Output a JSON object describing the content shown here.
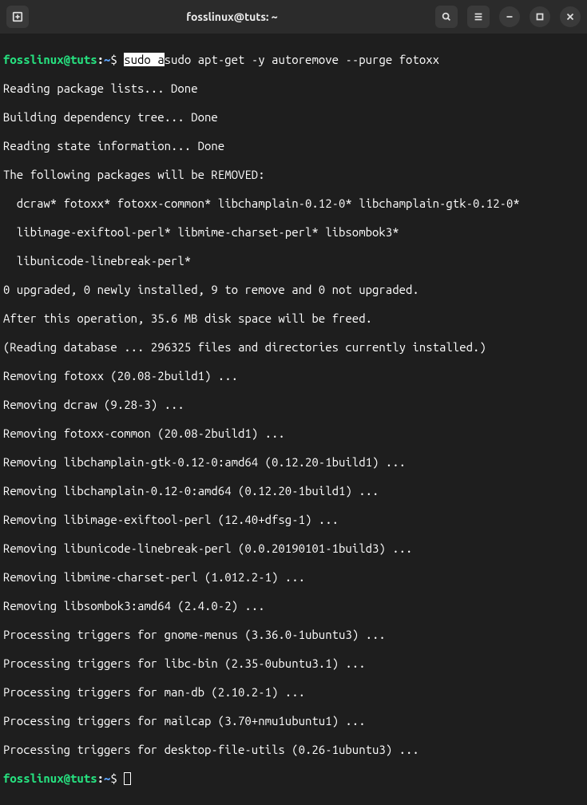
{
  "titlebar": {
    "title": "fosslinux@tuts: ~"
  },
  "prompt": {
    "user_host": "fosslinux@tuts",
    "sep": ":",
    "path": "~",
    "dollar": "$"
  },
  "command": {
    "highlighted": "sudo a",
    "rest": "sudo apt-get -y autoremove --purge fotoxx"
  },
  "output": [
    "Reading package lists... Done",
    "Building dependency tree... Done",
    "Reading state information... Done",
    "The following packages will be REMOVED:",
    "  dcraw* fotoxx* fotoxx-common* libchamplain-0.12-0* libchamplain-gtk-0.12-0*",
    "  libimage-exiftool-perl* libmime-charset-perl* libsombok3*",
    "  libunicode-linebreak-perl*",
    "0 upgraded, 0 newly installed, 9 to remove and 0 not upgraded.",
    "After this operation, 35.6 MB disk space will be freed.",
    "(Reading database ... 296325 files and directories currently installed.)",
    "Removing fotoxx (20.08-2build1) ...",
    "Removing dcraw (9.28-3) ...",
    "Removing fotoxx-common (20.08-2build1) ...",
    "Removing libchamplain-gtk-0.12-0:amd64 (0.12.20-1build1) ...",
    "Removing libchamplain-0.12-0:amd64 (0.12.20-1build1) ...",
    "Removing libimage-exiftool-perl (12.40+dfsg-1) ...",
    "Removing libunicode-linebreak-perl (0.0.20190101-1build3) ...",
    "Removing libmime-charset-perl (1.012.2-1) ...",
    "Removing libsombok3:amd64 (2.4.0-2) ...",
    "Processing triggers for gnome-menus (3.36.0-1ubuntu3) ...",
    "Processing triggers for libc-bin (2.35-0ubuntu3.1) ...",
    "Processing triggers for man-db (2.10.2-1) ...",
    "Processing triggers for mailcap (3.70+nmu1ubuntu1) ...",
    "Processing triggers for desktop-file-utils (0.26-1ubuntu3) ..."
  ]
}
